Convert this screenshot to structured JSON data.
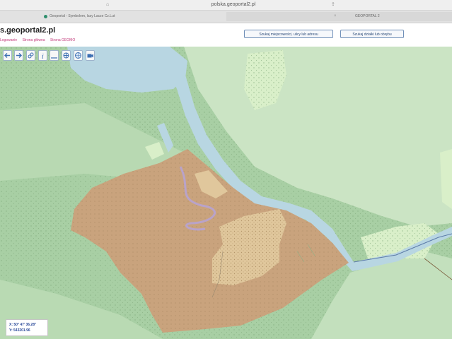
{
  "browser": {
    "url": "polska.geoportal2.pl",
    "tabs": [
      {
        "label": "Geoportal - Symbolem, lasy Lacze Cz.Lut"
      },
      {
        "label": "GEOPORTAL 2"
      }
    ]
  },
  "header": {
    "site_title": "s.geoportal2.pl",
    "nav_links": [
      "Logowanie",
      "Strona główna",
      "Strona GEOMO"
    ],
    "search_place_button": "Szukaj miejscowości, ulicy lub adresu",
    "search_parcel_button": "Szukaj działki lub obrębu"
  },
  "toolbar": {
    "tools": [
      {
        "name": "pan-left-icon"
      },
      {
        "name": "pan-right-icon"
      },
      {
        "name": "link-icon"
      },
      {
        "name": "info-icon"
      },
      {
        "name": "measure-icon"
      },
      {
        "name": "print-icon"
      },
      {
        "name": "globe-icon"
      },
      {
        "name": "camera-icon"
      }
    ]
  },
  "status": {
    "coord_x": "X: 50° 47' 36.28\"",
    "coord_y": "Y: 543201.96"
  },
  "colors": {
    "forest": "#a8cfa4",
    "meadow": "#cbe4c4",
    "water": "#b8d6e2",
    "farmland": "#c9a37d",
    "sand": "#e0c79c"
  }
}
